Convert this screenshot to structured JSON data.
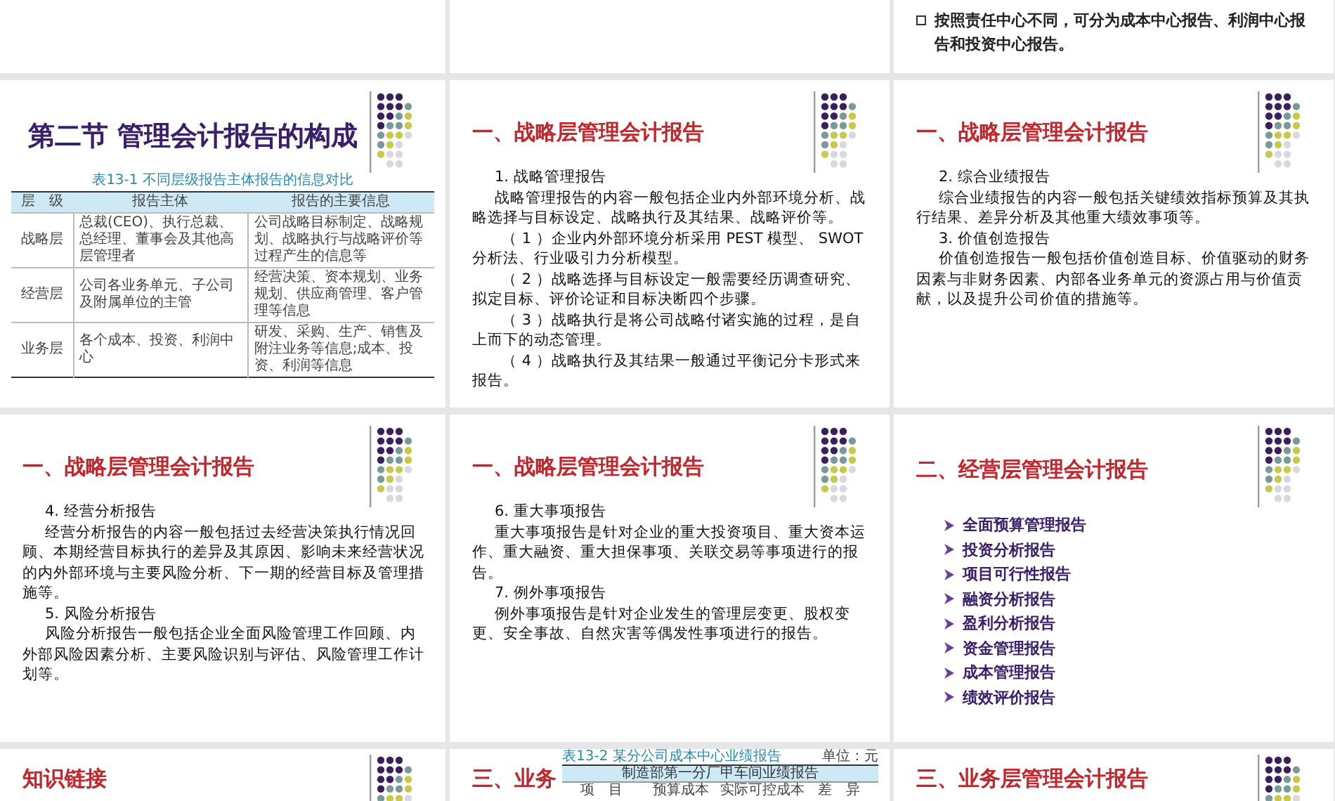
{
  "rows": [
    {
      "slides": [
        {
          "kind": "blank"
        },
        {
          "kind": "blank"
        },
        {
          "kind": "bullets",
          "bullets": [
            "按照责任中心不同，可分为成本中心报告、利润中心报告和投资中心报告。"
          ]
        }
      ]
    },
    {
      "slides": [
        {
          "kind": "table",
          "title": "第二节  管理会计报告的构成",
          "table": {
            "caption": "表13-1  不同层级报告主体报告的信息对比",
            "columns": [
              "层　级",
              "报告主体",
              "报告的主要信息"
            ],
            "rows": [
              [
                "战略层",
                "总裁(CEO)、执行总裁、总经理、董事会及其他高层管理者",
                "公司战略目标制定、战略规划、战略执行与战略评价等过程产生的信息等"
              ],
              [
                "经营层",
                "公司各业务单元、子公司及附属单位的主管",
                "经营决策、资本规划、业务规划、供应商管理、客户管理等信息"
              ],
              [
                "业务层",
                "各个成本、投资、利润中心",
                "研发、采购、生产、销售及附注业务等信息;成本、投资、利润等信息"
              ]
            ]
          }
        },
        {
          "kind": "text",
          "title": "一、战略层管理会计报告",
          "paragraphs": [
            {
              "kind": "heading",
              "text": "1. 战略管理报告"
            },
            {
              "kind": "para",
              "text": "战略管理报告的内容一般包括企业内外部环境分析、战略选择与目标设定、战略执行及其结果、战略评价等。"
            },
            {
              "kind": "item",
              "text": "（ 1 ）企业内外部环境分析采用 PEST 模型、 SWOT 分析法、行业吸引力分析模型。"
            },
            {
              "kind": "item",
              "text": "（ 2 ）战略选择与目标设定一般需要经历调查研究、拟定目标、评价论证和目标决断四个步骤。"
            },
            {
              "kind": "item",
              "text": "（ 3 ）战略执行是将公司战略付诸实施的过程，是自上而下的动态管理。"
            },
            {
              "kind": "item",
              "text": "（ 4 ）战略执行及其结果一般通过平衡记分卡形式来报告。"
            }
          ]
        },
        {
          "kind": "text",
          "title": "一、战略层管理会计报告",
          "paragraphs": [
            {
              "kind": "heading",
              "text": "2. 综合业绩报告"
            },
            {
              "kind": "para",
              "text": "综合业绩报告的内容一般包括关键绩效指标预算及其执行结果、差异分析及其他重大绩效事项等。"
            },
            {
              "kind": "heading",
              "text": "3. 价值创造报告"
            },
            {
              "kind": "para",
              "text": "价值创造报告一般包括价值创造目标、价值驱动的财务因素与非财务因素、内部各业务单元的资源占用与价值贡献，以及提升公司价值的措施等。"
            }
          ]
        }
      ]
    },
    {
      "slides": [
        {
          "kind": "text",
          "title": "一、战略层管理会计报告",
          "paragraphs": [
            {
              "kind": "heading",
              "text": "4. 经营分析报告"
            },
            {
              "kind": "para",
              "text": "经营分析报告的内容一般包括过去经营决策执行情况回顾、本期经营目标执行的差异及其原因、影响未来经营状况的内外部环境与主要风险分析、下一期的经营目标及管理措施等。"
            },
            {
              "kind": "heading",
              "text": "5. 风险分析报告"
            },
            {
              "kind": "para",
              "text": "风险分析报告一般包括企业全面风险管理工作回顾、内外部风险因素分析、主要风险识别与评估、风险管理工作计划等。"
            }
          ]
        },
        {
          "kind": "text",
          "title": "一、战略层管理会计报告",
          "paragraphs": [
            {
              "kind": "heading",
              "text": "6. 重大事项报告"
            },
            {
              "kind": "para",
              "text": "重大事项报告是针对企业的重大投资项目、重大资本运作、重大融资、重大担保事项、关联交易等事项进行的报告。"
            },
            {
              "kind": "heading",
              "text": "7. 例外事项报告"
            },
            {
              "kind": "para",
              "text": "例外事项报告是针对企业发生的管理层变更、股权变更、安全事故、自然灾害等偶发性事项进行的报告。"
            }
          ]
        },
        {
          "kind": "list",
          "title": "二、经营层管理会计报告",
          "items": [
            "全面预算管理报告",
            "投资分析报告",
            "项目可行性报告",
            "融资分析报告",
            "盈利分析报告",
            "资金管理报告",
            "成本管理报告",
            "绩效评价报告"
          ]
        }
      ]
    },
    {
      "slides": [
        {
          "kind": "partial",
          "title": "知识链接"
        },
        {
          "kind": "partial_table",
          "title": "三、业务",
          "table": {
            "caption": "表13-2  某分公司成本中心业绩报告",
            "unit": "单位：元",
            "header": "制造部第一分厂甲车间业绩报告",
            "columns": [
              "项　目",
              "预算成本",
              "实际可控成本",
              "差　异"
            ]
          }
        },
        {
          "kind": "partial",
          "title": "三、业务层管理会计报告"
        }
      ]
    }
  ]
}
